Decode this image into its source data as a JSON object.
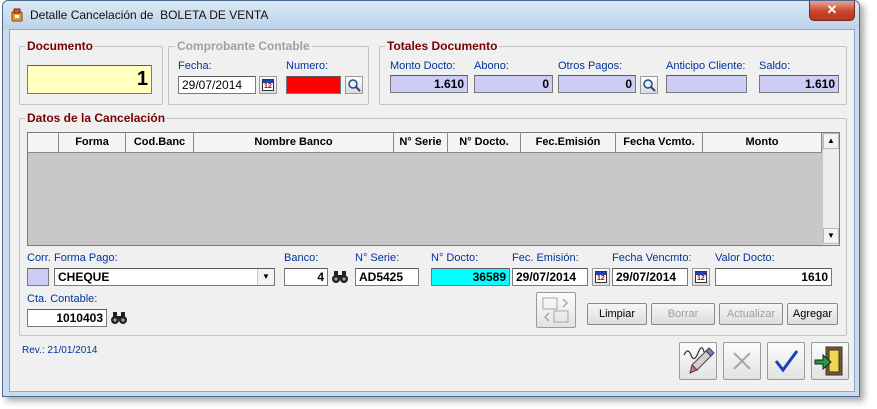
{
  "window": {
    "title": "Detalle Cancelación de  BOLETA DE VENTA",
    "close_label": "✕"
  },
  "documento": {
    "title": "Documento",
    "value": "1"
  },
  "comprobante": {
    "title": "Comprobante Contable",
    "fecha_label": "Fecha:",
    "fecha_value": "29/07/2014",
    "numero_label": "Numero:",
    "numero_value": ""
  },
  "totales": {
    "title": "Totales Documento",
    "monto_label": "Monto Docto:",
    "monto_value": "1.610",
    "abono_label": "Abono:",
    "abono_value": "0",
    "otros_label": "Otros Pagos:",
    "otros_value": "0",
    "anticipo_label": "Anticipo Cliente:",
    "anticipo_value": "",
    "saldo_label": "Saldo:",
    "saldo_value": "1.610"
  },
  "cancelacion": {
    "title": "Datos de la Cancelación",
    "columns": [
      "",
      "Forma",
      "Cod.Banc",
      "Nombre Banco",
      "N° Serie",
      "N° Docto.",
      "Fec.Emisión",
      "Fecha Vcmto.",
      "Monto"
    ],
    "rows": []
  },
  "form": {
    "corr_label": "Corr.",
    "corr_value": "",
    "forma_label": "Forma Pago:",
    "forma_value": "CHEQUE",
    "banco_label": "Banco:",
    "banco_value": "4",
    "serie_label": "N° Serie:",
    "serie_value": "AD5425",
    "docto_label": "N° Docto:",
    "docto_value": "36589",
    "emision_label": "Fec. Emisión:",
    "emision_value": "29/07/2014",
    "vencmto_label": "Fecha Vencmto:",
    "vencmto_value": "29/07/2014",
    "valor_label": "Valor Docto:",
    "valor_value": "1610",
    "cta_label": "Cta. Contable:",
    "cta_value": "1010403"
  },
  "buttons": {
    "limpiar": "Limpiar",
    "borrar": "Borrar",
    "actualizar": "Actualizar",
    "agregar": "Agregar"
  },
  "footer": {
    "rev": "Rev.: 21/01/2014"
  },
  "colors": {
    "numero_bg": "#ff0000",
    "docto_bg": "#00ffff",
    "saldo_bg": "#ccccf4",
    "documento_bg": "#ffffc0"
  }
}
